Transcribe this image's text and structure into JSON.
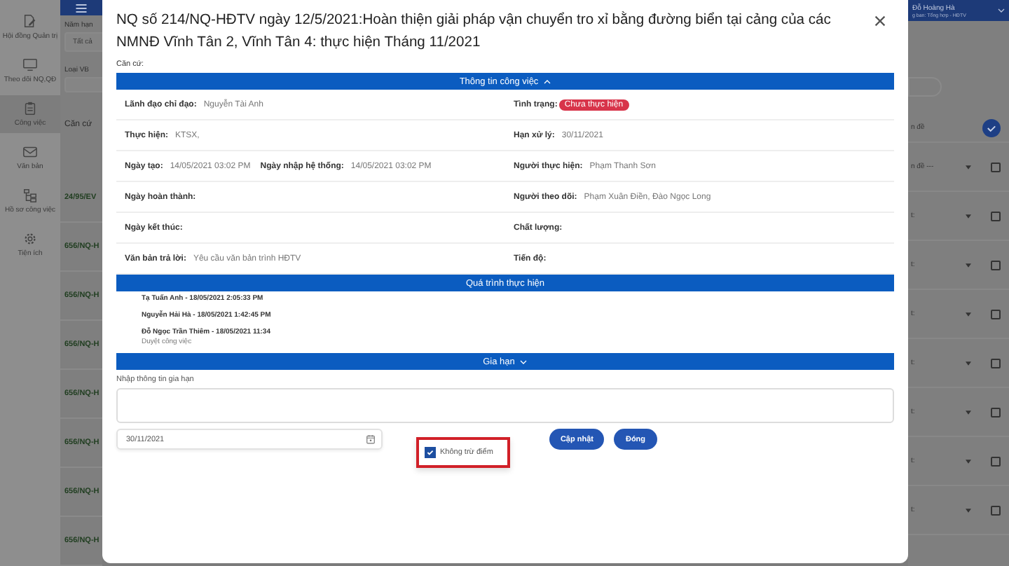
{
  "sidebar": {
    "items": [
      {
        "label": "Hội đồng Quản trị",
        "selected": false
      },
      {
        "label": "Theo dõi NQ,QĐ",
        "selected": false
      },
      {
        "label": "Công việc",
        "selected": true
      },
      {
        "label": "Văn bản",
        "selected": false
      },
      {
        "label": "Hồ sơ công việc",
        "selected": false
      },
      {
        "label": "Tiện ích",
        "selected": false
      }
    ]
  },
  "list_panel": {
    "filters": [
      {
        "label": "Năm hạn",
        "value": "Tất cả"
      },
      {
        "label": "Loại VB"
      }
    ],
    "column_header": "Căn cứ",
    "rows": [
      "24/95/EV",
      "656/NQ-H",
      "656/NQ-H",
      "656/NQ-H",
      "656/NQ-H",
      "656/NQ-H",
      "656/NQ-H",
      "656/NQ-H"
    ]
  },
  "header": {
    "user_name": "Đỗ Hoàng Hà",
    "user_role": "g ban: Tổng hợp - HĐTV"
  },
  "right_panel": {
    "column_header": "n đề",
    "rows": [
      {
        "text": "n đề ---",
        "checked": false
      },
      {
        "text": "t:",
        "checked": false
      },
      {
        "text": "t:",
        "checked": false
      },
      {
        "text": "t:",
        "checked": false
      },
      {
        "text": "t:",
        "checked": false
      },
      {
        "text": "t:",
        "checked": false
      },
      {
        "text": "t:",
        "checked": false
      },
      {
        "text": "t:",
        "checked": false
      }
    ]
  },
  "dialog": {
    "title": "NQ số 214/NQ-HĐTV ngày 12/5/2021:Hoàn thiện giải pháp vận chuyển tro xỉ bằng đường biển tại cảng của các NMNĐ Vĩnh Tân 2, Vĩnh Tân 4: thực hiện Tháng 11/2021",
    "basis_label": "Căn cứ:",
    "sections": [
      {
        "kind": "info",
        "title": "Thông tin công việc",
        "expanded": true,
        "rows": [
          {
            "left": [
              {
                "label": "Lãnh đạo chỉ đạo:",
                "value": "Nguyễn Tài Anh",
                "kind": "text"
              }
            ],
            "right": [
              {
                "label": "Tình trạng:",
                "value": "Chưa thực hiện",
                "kind": "badge"
              }
            ]
          },
          {
            "left": [
              {
                "label": "Thực hiện:",
                "value": "KTSX,",
                "kind": "text"
              }
            ],
            "right": [
              {
                "label": "Hạn xử lý:",
                "value": "30/11/2021",
                "kind": "text"
              }
            ]
          },
          {
            "left": [
              {
                "label": "Ngày tạo:",
                "value": "14/05/2021 03:02 PM",
                "kind": "text"
              },
              {
                "label": "Ngày nhập hệ thống:",
                "value": "14/05/2021 03:02 PM",
                "kind": "text"
              }
            ],
            "right": [
              {
                "label": "Người thực hiện:",
                "value": "Phạm Thanh Sơn",
                "kind": "text"
              }
            ]
          },
          {
            "left": [
              {
                "label": "Ngày hoàn thành:"
              }
            ],
            "right": [
              {
                "label": "Người theo dõi:",
                "value": "Phạm Xuân Điền, Đào Ngọc Long",
                "kind": "text"
              }
            ]
          },
          {
            "left": [
              {
                "label": "Ngày kết thúc:"
              }
            ],
            "right": [
              {
                "label": "Chất lượng:"
              }
            ]
          },
          {
            "left": [
              {
                "label": "Văn bản trả lời:",
                "value": "Yêu cầu văn bản trình HĐTV",
                "kind": "text"
              }
            ],
            "right": [
              {
                "label": "Tiến độ:"
              }
            ]
          }
        ]
      },
      {
        "kind": "log",
        "title": "Quá trình thực hiện",
        "entries": [
          {
            "title": "Tạ Tuấn Anh - 18/05/2021 2:05:33 PM"
          },
          {
            "title": "Nguyễn Hải Hà - 18/05/2021 1:42:45 PM"
          },
          {
            "title": "Đỗ Ngọc Trần Thiêm - 18/05/2021 11:34",
            "note": "Duyệt công việc"
          }
        ]
      },
      {
        "kind": "extend",
        "title": "Gia hạn",
        "expanded": false,
        "note_label": "Nhập thông tin gia hạn",
        "date": "30/11/2021",
        "checkbox": {
          "label": "Không trừ điểm",
          "checked": true
        },
        "buttons": [
          "Cập nhật",
          "Đóng"
        ]
      }
    ]
  }
}
